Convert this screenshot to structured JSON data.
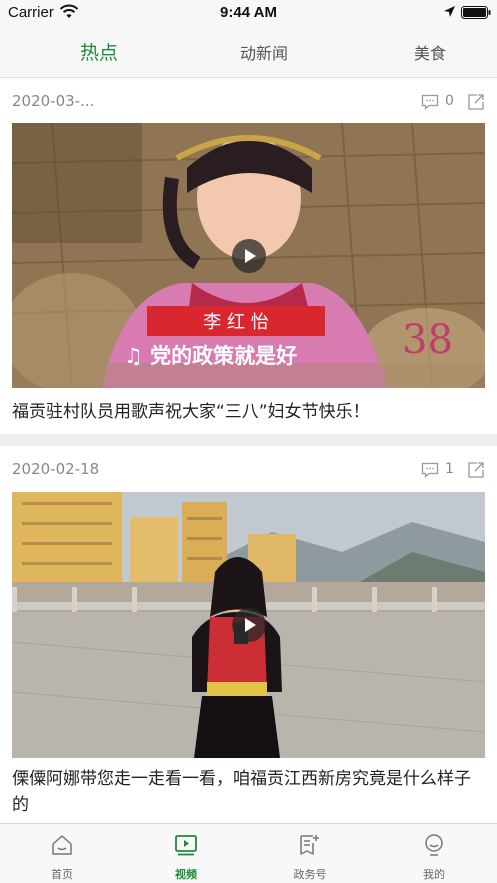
{
  "status_bar": {
    "carrier": "Carrier",
    "time": "9:44 AM"
  },
  "tabs": [
    {
      "label": "热点",
      "active": true
    },
    {
      "label": "动新闻",
      "active": false
    },
    {
      "label": "美食",
      "active": false
    }
  ],
  "feed": [
    {
      "date": "2020-03-...",
      "comment_count": "0",
      "title": "福贡驻村队员用歌声祝大家“三八”妇女节快乐！",
      "overlay_name": "李 红 怡",
      "overlay_song": "♫ 党的政策就是好"
    },
    {
      "date": "2020-02-18",
      "comment_count": "1",
      "title": "傈僳阿娜带您走一走看一看，咱福贡江西新房究竟是什么样子的"
    }
  ],
  "bottom_nav": [
    {
      "label": "首页",
      "icon": "home-icon",
      "active": false
    },
    {
      "label": "视频",
      "icon": "video-icon",
      "active": true
    },
    {
      "label": "政务号",
      "icon": "gov-account-icon",
      "active": false
    },
    {
      "label": "我的",
      "icon": "profile-icon",
      "active": false
    }
  ],
  "colors": {
    "accent": "#1e8a3a",
    "text": "#222222",
    "muted": "#888888",
    "background": "#efefef"
  }
}
